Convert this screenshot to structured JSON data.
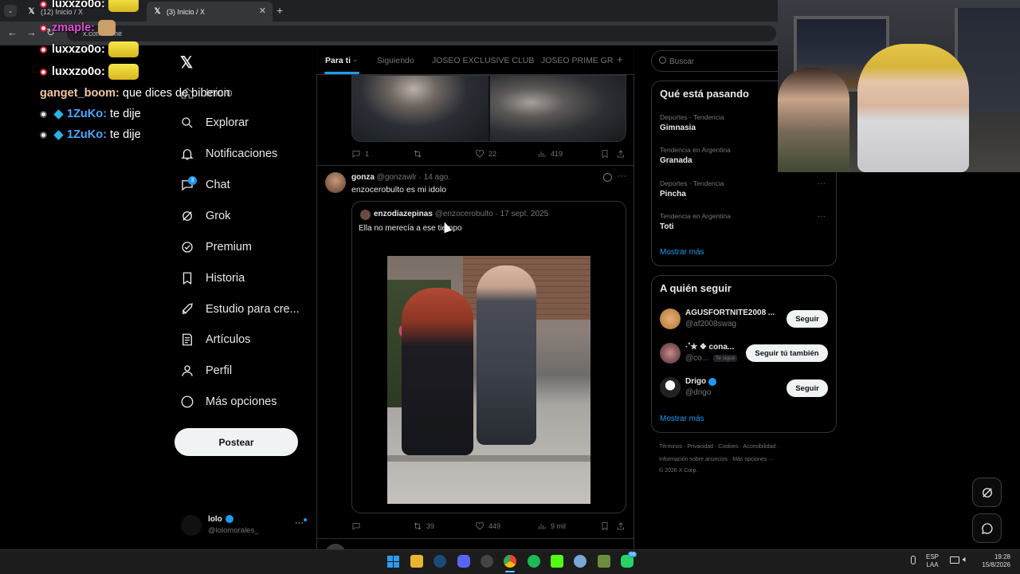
{
  "browser": {
    "tabs": [
      {
        "label": "(12) Inicio / X"
      },
      {
        "label": "(3) Inicio / X"
      }
    ],
    "url": "x.com/home"
  },
  "chat": [
    {
      "user": "luxxzo0o:",
      "msg": "",
      "emote": true
    },
    {
      "user": "zmaple:",
      "msg": "",
      "emote": false
    },
    {
      "user": "luxxzo0o:",
      "msg": "",
      "emote": true
    },
    {
      "user": "luxxzo0o:",
      "msg": "",
      "emote": true
    },
    {
      "user": "ganget_boom:",
      "msg": " que dices de biberon"
    },
    {
      "user": "1ZuKo:",
      "msg": " te dije"
    },
    {
      "user": "1ZuKo:",
      "msg": " te dije"
    }
  ],
  "nav": {
    "home_label": "Inicio",
    "items": [
      {
        "label": "Explorar"
      },
      {
        "label": "Notificaciones"
      },
      {
        "label": "Chat",
        "badge": "3"
      },
      {
        "label": "Grok"
      },
      {
        "label": "Premium"
      },
      {
        "label": "Historia"
      },
      {
        "label": "Estudio para cre..."
      },
      {
        "label": "Artículos"
      },
      {
        "label": "Perfil"
      },
      {
        "label": "Más opciones"
      }
    ],
    "post_label": "Postear",
    "account": {
      "name": "lolo",
      "handle": "@lolomorales_"
    }
  },
  "feed": {
    "tabs": [
      "Para ti",
      "Siguiendo",
      "JOSEO EXCLUSIVE CLUB",
      "JOSEO PRIME GR"
    ],
    "prev_actions": {
      "replies": "1",
      "reposts": "",
      "likes": "22",
      "views": "419"
    },
    "post": {
      "name": "gonza",
      "handle": "@gonzawlr",
      "time": "· 14 ago.",
      "text": "enzocerobulto es mi idolo",
      "quote": {
        "name": "enzodiazepinas",
        "handle": "@enzocerobulto",
        "time": "· 17 sept. 2025",
        "text": "Ella no merecía a ese tiempo"
      },
      "actions": {
        "replies": "",
        "reposts": "39",
        "likes": "449",
        "views": "9 mil"
      }
    }
  },
  "search": {
    "placeholder": "Buscar"
  },
  "trends": {
    "title": "Qué está pasando",
    "items": [
      {
        "category": "Deportes · Tendencia",
        "name": "Gimnasia"
      },
      {
        "category": "Tendencia en Argentina",
        "name": "Granada"
      },
      {
        "category": "Deportes · Tendencia",
        "name": "Pincha"
      },
      {
        "category": "Tendencia en Argentina",
        "name": "Toti"
      }
    ],
    "more": "Mostrar más"
  },
  "follow": {
    "title": "A quién seguir",
    "items": [
      {
        "name": "AGUSFORTNITE2008 ...",
        "handle": "@af2008swag",
        "button": "Seguir"
      },
      {
        "name": "·˚✮ ❖ cona...",
        "handle": "@co...",
        "tag": "Te sigue",
        "button": "Seguir tú también"
      },
      {
        "name": "Drigo",
        "handle": "@drigo",
        "button": "Seguir"
      }
    ],
    "more": "Mostrar más"
  },
  "footer": {
    "line1": "Términos · Privacidad · Cookies · Accesibilidad ·",
    "line2": "Información sobre anuncios · Más opciones ···",
    "line3": "© 2026 X Corp."
  },
  "taskbar": {
    "lang": "ESP",
    "lang2": "LAA",
    "time": "19:28",
    "date": "15/8/2026",
    "badge": "56"
  },
  "colors": {
    "accent": "#1d9bf0",
    "bg": "#000000",
    "border": "#2f3336"
  }
}
